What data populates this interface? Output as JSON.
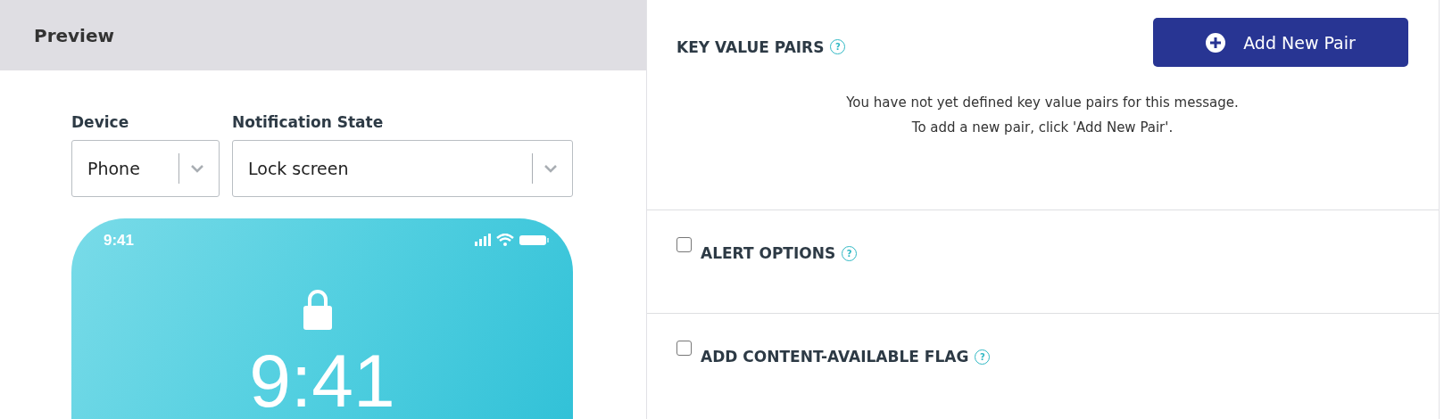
{
  "preview": {
    "title": "Preview",
    "fields": [
      {
        "label": "Device",
        "value": "Phone"
      },
      {
        "label": "Notification State",
        "value": "Lock screen"
      }
    ],
    "phone": {
      "status_time": "9:41",
      "clock": "9:41"
    }
  },
  "key_value_pairs": {
    "title": "KEY VALUE PAIRS",
    "help": "?",
    "button": "Add New Pair",
    "empty_message": [
      "You have not yet defined key value pairs for this message.",
      "To add a new pair, click 'Add New Pair'."
    ]
  },
  "options": [
    {
      "title": "ALERT OPTIONS",
      "help": "?",
      "checked": false
    },
    {
      "title": "ADD CONTENT-AVAILABLE FLAG",
      "help": "?",
      "checked": false
    }
  ]
}
